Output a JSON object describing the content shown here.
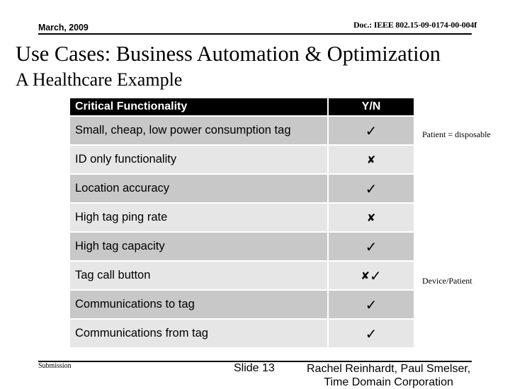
{
  "header": {
    "date": "March, 2009",
    "doc_id": "Doc.: IEEE 802.15-09-0174-00-004f"
  },
  "title": "Use Cases: Business Automation & Optimization",
  "subtitle": "A Healthcare Example",
  "table": {
    "columns": [
      "Critical Functionality",
      "Y/N"
    ],
    "rows": [
      {
        "feature": "Small, cheap, low power consumption tag",
        "value": "✓",
        "value_icon": "check-icon"
      },
      {
        "feature": "ID only functionality",
        "value": "✘",
        "value_icon": "cross-icon"
      },
      {
        "feature": "Location accuracy",
        "value": "✓",
        "value_icon": "check-icon"
      },
      {
        "feature": "High tag ping rate",
        "value": "✘",
        "value_icon": "cross-icon"
      },
      {
        "feature": "High tag capacity",
        "value": "✓",
        "value_icon": "check-icon"
      },
      {
        "feature": "Tag call button",
        "value_cross": "✘",
        "value_check": "✓",
        "value_icon": "cross-check-icon"
      },
      {
        "feature": "Communications to tag",
        "value": "✓",
        "value_icon": "check-icon"
      },
      {
        "feature": "Communications from tag",
        "value": "✓",
        "value_icon": "check-icon"
      }
    ],
    "colors": {
      "header_bg": "#000000",
      "row_dark": "#c8c8c8",
      "row_light": "#e6e6e6"
    }
  },
  "notes": [
    {
      "row": 0,
      "text": "Patient = disposable"
    },
    {
      "row": 5,
      "text": "Device/Patient"
    }
  ],
  "footer": {
    "left": "Submission",
    "slide": "Slide 13",
    "author_line1": "Rachel Reinhardt, Paul Smelser,",
    "author_line2": "Time Domain Corporation"
  }
}
